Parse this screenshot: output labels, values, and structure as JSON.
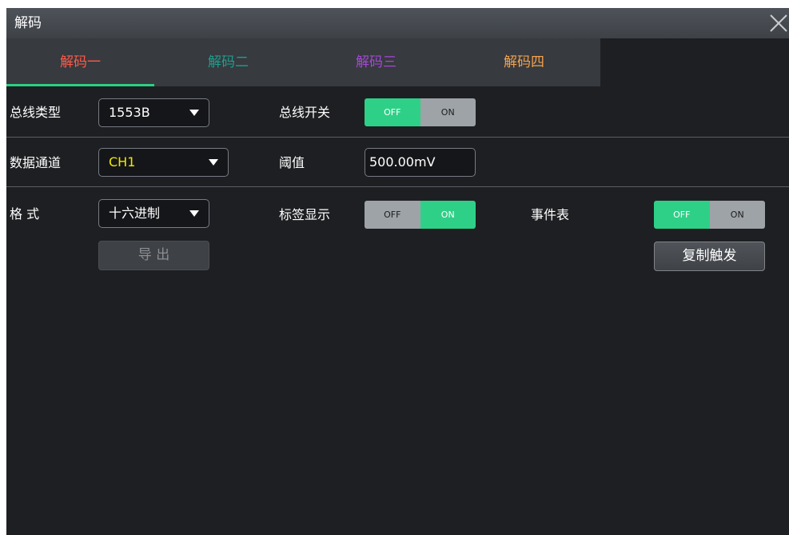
{
  "window": {
    "title": "解码"
  },
  "tabs": [
    {
      "label": "解码一",
      "color": "#ff5a47",
      "active": true
    },
    {
      "label": "解码二",
      "color": "#1f9e8e",
      "active": false
    },
    {
      "label": "解码三",
      "color": "#a548d6",
      "active": false
    },
    {
      "label": "解码四",
      "color": "#f3a24d",
      "active": false
    }
  ],
  "row1": {
    "bus_type_label": "总线类型",
    "bus_type_value": "1553B",
    "bus_switch_label": "总线开关",
    "bus_switch": {
      "off_label": "OFF",
      "on_label": "ON",
      "state": "off"
    }
  },
  "row2": {
    "data_channel_label": "数据通道",
    "data_channel_value": "CH1",
    "data_channel_color": "#f0e800",
    "threshold_label": "阈值",
    "threshold_value": "500.00mV"
  },
  "row3": {
    "format_label": "格 式",
    "format_value": "十六进制",
    "label_display_label": "标签显示",
    "label_display": {
      "off_label": "OFF",
      "on_label": "ON",
      "state": "on"
    },
    "event_table_label": "事件表",
    "event_table": {
      "off_label": "OFF",
      "on_label": "ON",
      "state": "off"
    },
    "export_label": "导 出",
    "copy_trigger_label": "复制触发"
  },
  "colors": {
    "accent_green": "#2ed087",
    "toggle_grey": "#9ea3a8"
  }
}
